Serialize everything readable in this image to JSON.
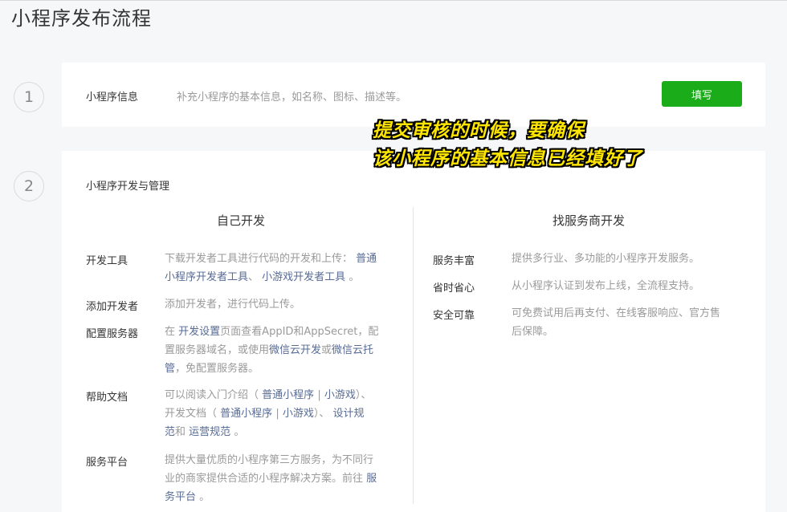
{
  "page": {
    "title": "小程序发布流程"
  },
  "steps": [
    {
      "num": "1"
    },
    {
      "num": "2"
    }
  ],
  "step1": {
    "label": "小程序信息",
    "desc": "补充小程序的基本信息，如名称、图标、描述等。",
    "button": "填写"
  },
  "overlay": {
    "line1": "提交审核的时候，要确保",
    "line2": "该小程序的基本信息已经填好了"
  },
  "step2": {
    "title": "小程序开发与管理",
    "left": {
      "title": "自己开发",
      "rows": [
        {
          "label": "开发工具",
          "lines": [
            [
              "下载开发者工具进行代码的开发和上传：",
              "普通"
            ],
            [
              "小程序开发者工具",
              "、",
              "小游戏开发者工具",
              "。"
            ]
          ]
        },
        {
          "label": "添加开发者",
          "lines": [
            [
              "添加开发者，进行代码上传。"
            ]
          ]
        },
        {
          "label": "配置服务器",
          "lines": [
            [
              "在",
              "开发设置",
              "页面查看AppID和AppSecret，配"
            ],
            [
              "置服务器域名，或使用",
              "微信云开发",
              "或",
              "微信云托"
            ],
            [
              "管",
              "，免配置服务器。"
            ]
          ]
        },
        {
          "label": "帮助文档",
          "lines": [
            [
              "可以阅读入门介绍（",
              "普通小程序",
              "|",
              "小游戏",
              "）、"
            ],
            [
              "开发文档（",
              "普通小程序",
              "|",
              "小游戏",
              "）、",
              "设计规"
            ],
            [
              "范",
              "和",
              "运营规范",
              "。"
            ]
          ]
        },
        {
          "label": "服务平台",
          "lines": [
            [
              "提供大量优质的小程序第三方服务，为不同行"
            ],
            [
              "业的商家提供合适的小程序解决方案。前往",
              "服"
            ],
            [
              "务平台",
              "。"
            ]
          ]
        }
      ]
    },
    "right": {
      "title": "找服务商开发",
      "rows": [
        {
          "label": "服务丰富",
          "lines": [
            [
              "提供多行业、多功能的小程序开发服务。"
            ]
          ]
        },
        {
          "label": "省时省心",
          "lines": [
            [
              "从小程序认证到发布上线，全流程支持。"
            ]
          ]
        },
        {
          "label": "安全可靠",
          "lines": [
            [
              "可免费试用后再支付、在线客服响应、官方售"
            ],
            [
              "后保障。"
            ]
          ]
        }
      ]
    }
  }
}
